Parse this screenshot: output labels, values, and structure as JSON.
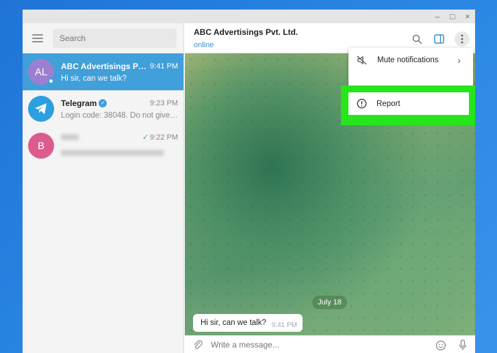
{
  "window": {
    "controls": [
      "–",
      "□",
      "×"
    ]
  },
  "sidebar": {
    "search_placeholder": "Search",
    "chats": [
      {
        "initials": "AL",
        "name": "ABC Advertisings Pvt. L...",
        "time": "9:41 PM",
        "message": "Hi sir, can we talk?",
        "avatar_color": "#9d7fd1",
        "active": true
      },
      {
        "initials": "",
        "name": "Telegram",
        "time": "9:23 PM",
        "message": "Login code: 38048. Do not give t...",
        "avatar_color": "#2c9fe0",
        "verified": true
      },
      {
        "initials": "B",
        "name": "",
        "time": "9:22 PM",
        "message": "",
        "avatar_color": "#dd5c8f",
        "read": true
      }
    ]
  },
  "header": {
    "title": "ABC Advertisings Pvt. Ltd.",
    "status": "online"
  },
  "menu": {
    "items": [
      {
        "label": "Mute notifications",
        "icon": "mute-icon"
      },
      {
        "label": "Report",
        "icon": "report-icon"
      }
    ]
  },
  "chat": {
    "date_label": "July 18",
    "messages": [
      {
        "text": "Hi sir, can we talk?",
        "time": "9:41 PM"
      }
    ]
  },
  "composer": {
    "placeholder": "Write a message..."
  },
  "colors": {
    "accent": "#419fd9",
    "highlight": "#27e51b"
  }
}
